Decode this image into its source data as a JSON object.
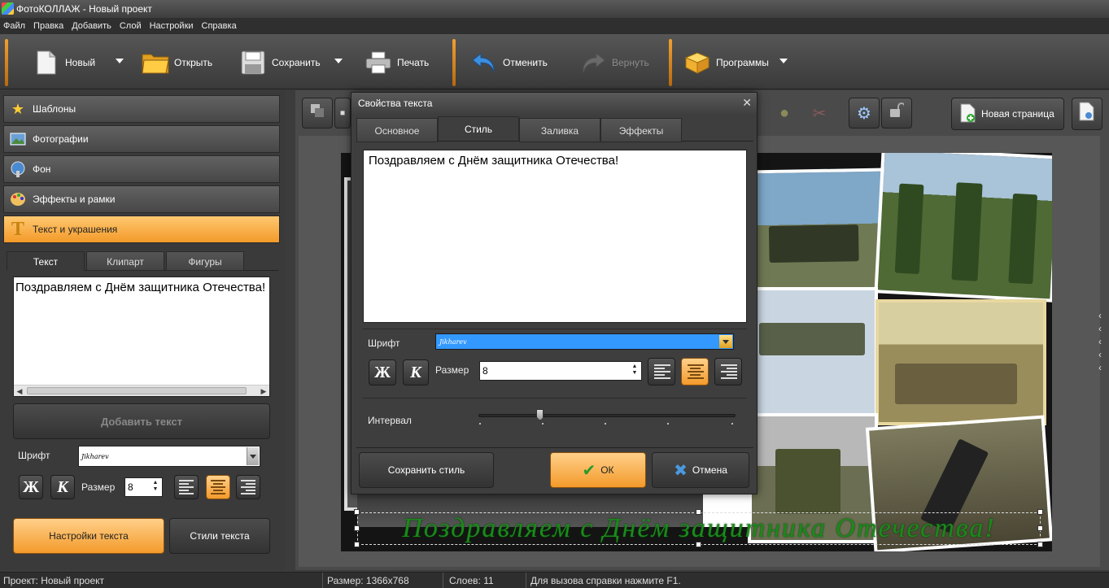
{
  "window": {
    "title": "ФотоКОЛЛАЖ - Новый проект"
  },
  "menu": [
    "Файл",
    "Правка",
    "Добавить",
    "Слой",
    "Настройки",
    "Справка"
  ],
  "toolbar": {
    "new": "Новый",
    "open": "Открыть",
    "save": "Сохранить",
    "print": "Печать",
    "undo": "Отменить",
    "redo": "Вернуть",
    "programs": "Программы"
  },
  "categories": [
    "Шаблоны",
    "Фотографии",
    "Фон",
    "Эффекты и рамки",
    "Текст и украшения"
  ],
  "subtabs": [
    "Текст",
    "Клипарт",
    "Фигуры"
  ],
  "left": {
    "text_value": "Поздравляем с Днём защитника Отечества!",
    "add_text": "Добавить текст",
    "font_label": "Шрифт",
    "font_value": "Jikharev",
    "bold": "Ж",
    "italic": "К",
    "size_label": "Размер",
    "size_value": "8",
    "text_settings": "Настройки текста",
    "text_styles": "Стили текста"
  },
  "workspace": {
    "new_page": "Новая страница",
    "canvas_text": "Поздравляем с Днём защитника Отечества!"
  },
  "dialog": {
    "title": "Свойства текста",
    "tabs": [
      "Основное",
      "Стиль",
      "Заливка",
      "Эффекты"
    ],
    "text_value": "Поздравляем с Днём защитника Отечества!",
    "font_label": "Шрифт",
    "font_value": "Jikharev",
    "bold": "Ж",
    "italic": "К",
    "size_label": "Размер",
    "size_value": "8",
    "interval_label": "Интервал",
    "interval_level": 0.24,
    "save_style": "Сохранить стиль",
    "ok": "ОК",
    "cancel": "Отмена"
  },
  "status": {
    "project_label": "Проект:",
    "project_value": "Новый проект",
    "size_label": "Размер:",
    "size_value": "1366x768",
    "layers_label": "Слоев:",
    "layers_value": "11",
    "help": "Для вызова справки нажмите F1."
  },
  "colors": {
    "accent": "#f39a2a",
    "canvas_text": "#1a8a1a",
    "selected_font": "#3399ff"
  }
}
